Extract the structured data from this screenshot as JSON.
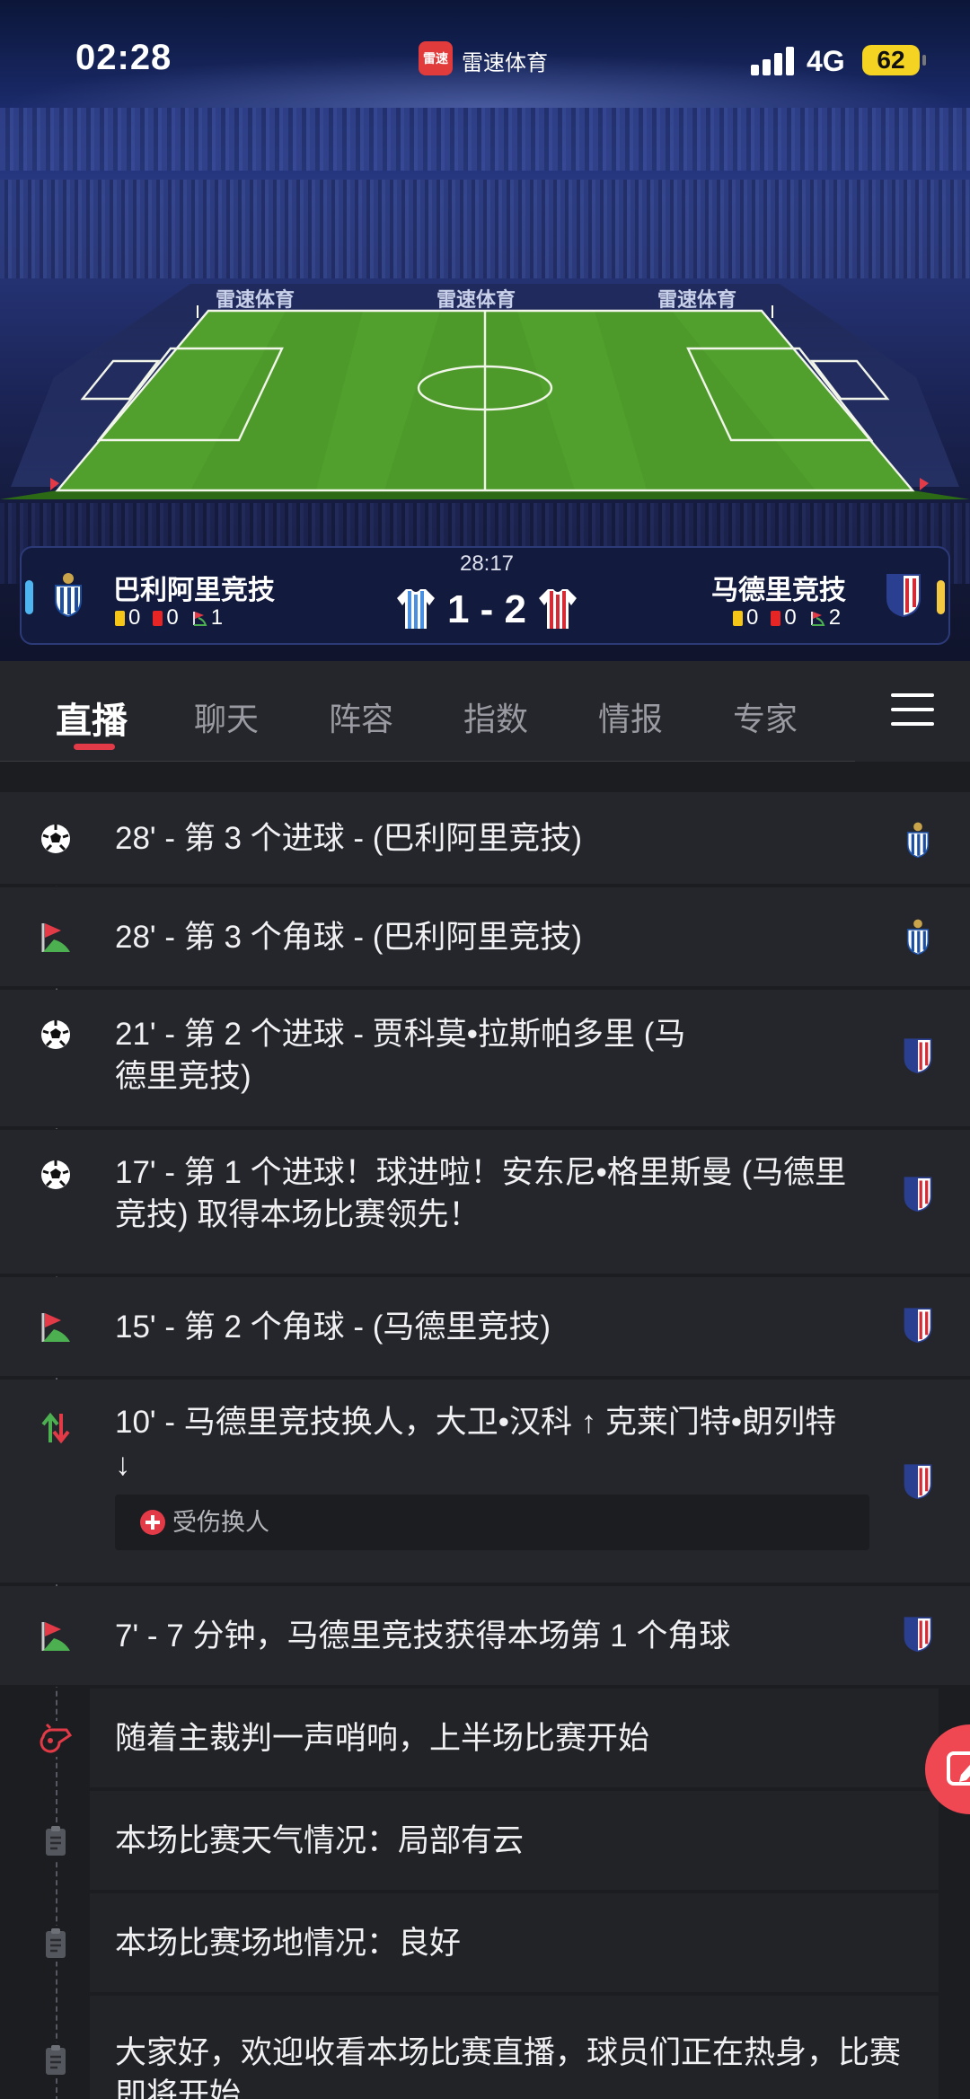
{
  "status_bar": {
    "time": "02:28",
    "app_badge": "雷速",
    "app_name": "雷速体育",
    "network": "4G",
    "battery": "62"
  },
  "pitch_ads": [
    "雷速体育",
    "雷速体育",
    "雷速体育"
  ],
  "match": {
    "clock": "28:17",
    "score": "1 - 2",
    "home": {
      "name": "巴利阿里竞技",
      "yellow": "0",
      "red": "0",
      "corners": "1"
    },
    "away": {
      "name": "马德里竞技",
      "yellow": "0",
      "red": "0",
      "corners": "2"
    }
  },
  "tabs": [
    {
      "label": "直播",
      "active": true
    },
    {
      "label": "聊天"
    },
    {
      "label": "阵容"
    },
    {
      "label": "指数"
    },
    {
      "label": "情报"
    },
    {
      "label": "专家"
    }
  ],
  "events": [
    {
      "icon": "soccer-ball-icon",
      "text": "28' - 第 3 个进球 - (巴利阿里竞技)",
      "team": "home"
    },
    {
      "icon": "corner-flag-icon",
      "text": "28' - 第 3 个角球 - (巴利阿里竞技)",
      "team": "home"
    },
    {
      "icon": "soccer-ball-icon",
      "text": "21' - 第 2 个进球 - 贾科莫•拉斯帕多里 (马德里竞技)",
      "team": "away"
    },
    {
      "icon": "soccer-ball-icon",
      "text": "17' - 第 1 个进球！球进啦！安东尼•格里斯曼 (马德里竞技) 取得本场比赛领先！",
      "team": "away"
    },
    {
      "icon": "corner-flag-icon",
      "text": "15' - 第 2 个角球 - (马德里竞技)",
      "team": "away"
    },
    {
      "icon": "substitution-icon",
      "text": "10' - 马德里竞技换人，大卫•汉科 ↑ 克莱门特•朗列特 ↓",
      "team": "away",
      "tag": "受伤换人"
    },
    {
      "icon": "corner-flag-icon",
      "text": "7' - 7 分钟，马德里竞技获得本场第 1 个角球",
      "team": "away"
    },
    {
      "icon": "whistle-icon",
      "text": "随着主裁判一声哨响，上半场比赛开始"
    },
    {
      "icon": "clipboard-icon",
      "text": "本场比赛天气情况：局部有云"
    },
    {
      "icon": "clipboard-icon",
      "text": "本场比赛场地情况：良好"
    },
    {
      "icon": "clipboard-icon",
      "text": "大家好，欢迎收看本场比赛直播，球员们正在热身，比赛即将开始"
    }
  ],
  "colors": {
    "accent": "#e23b47",
    "home_kit": "#4a90e2",
    "away_kit": "#d62b35",
    "battery": "#f5d323"
  }
}
